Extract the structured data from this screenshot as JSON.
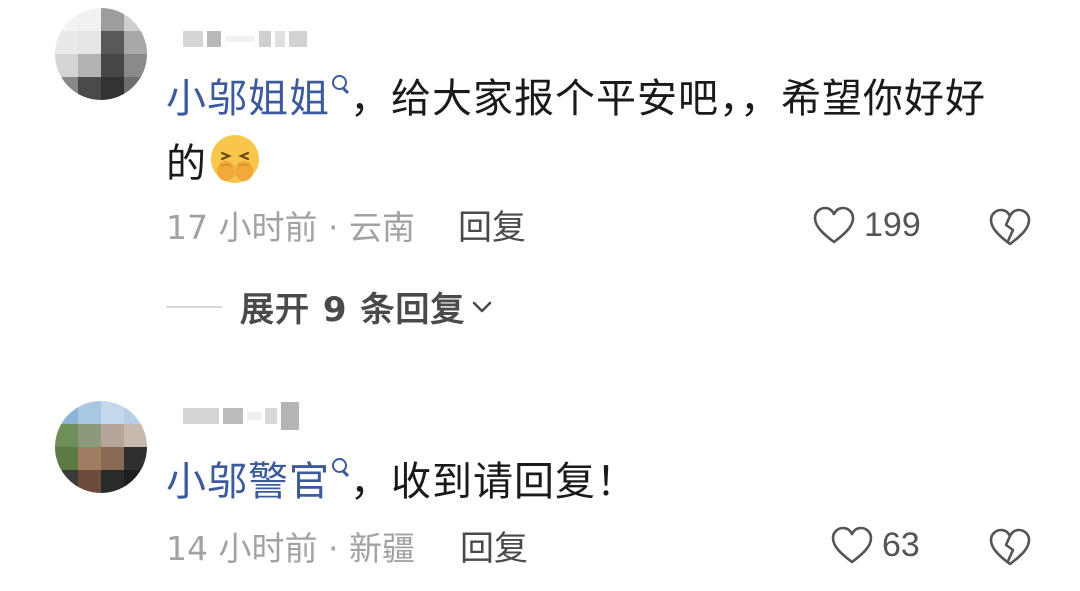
{
  "comments": [
    {
      "mention": "小邬姐姐",
      "text": "，给大家报个平安吧，，希望你好好的",
      "time": "17 小时前 · 云南",
      "reply_label": "回复",
      "likes": "199",
      "expand_label": "展开 9 条回复"
    },
    {
      "mention": "小邬警官",
      "text": "，收到请回复！",
      "time": "14 小时前 · 新疆",
      "reply_label": "回复",
      "likes": "63"
    }
  ],
  "colors": {
    "mention": "#3d5a9c",
    "meta": "#a2a2a2",
    "emoji_face": "#f7c64a"
  },
  "icons": [
    "search-icon",
    "emoji-covering-face",
    "heart-outline-icon",
    "broken-heart-icon",
    "chevron-down-icon"
  ]
}
